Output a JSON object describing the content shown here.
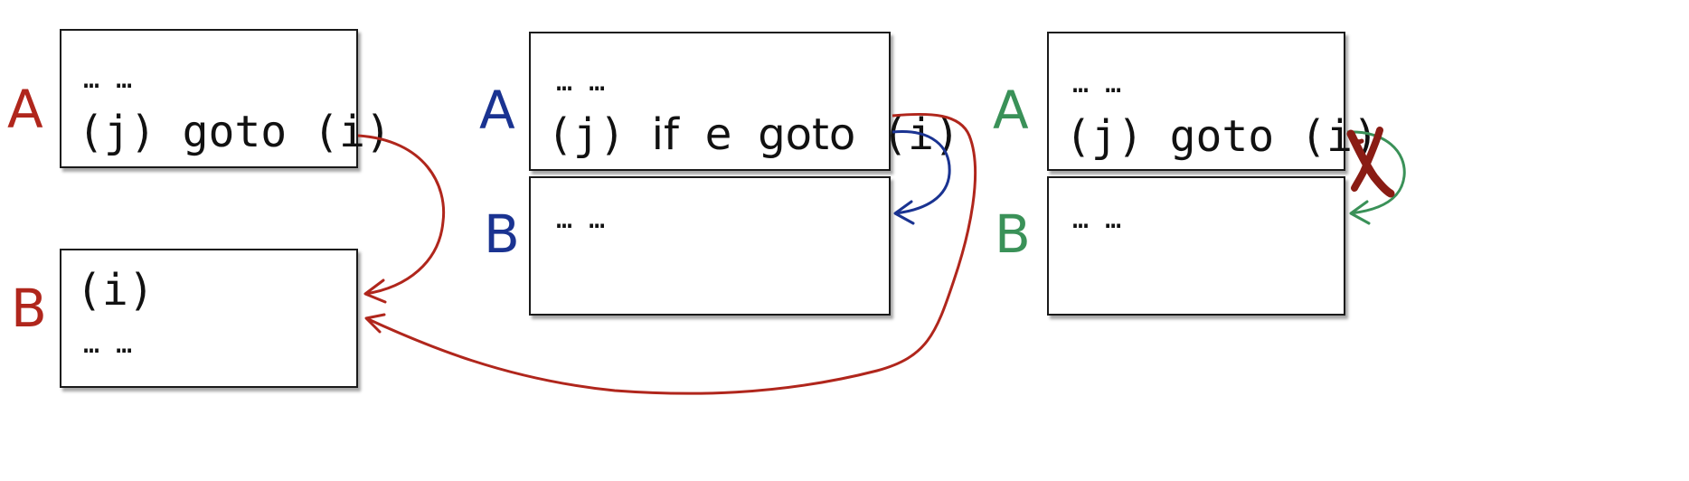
{
  "colors": {
    "red": "#b0261c",
    "blue": "#1a3391",
    "green": "#3a9158",
    "cross": "#8a1c14"
  },
  "panel1": {
    "label_a": "A",
    "label_b": "B",
    "box_a": {
      "dots": "… …",
      "code": "(j) goto (i)"
    },
    "box_b": {
      "code": "(i)",
      "dots": "… …"
    }
  },
  "panel2": {
    "label_a": "A",
    "label_b": "B",
    "box_a": {
      "dots": "… …",
      "code_j": "(j)",
      "code_if": "if",
      "code_e": "e",
      "code_goto": "goto",
      "code_i": "(i)"
    },
    "box_b": {
      "dots": "… …"
    }
  },
  "panel3": {
    "label_a": "A",
    "label_b": "B",
    "box_a": {
      "dots": "… …",
      "code": "(j) goto (i)"
    },
    "box_b": {
      "dots": "… …"
    }
  }
}
